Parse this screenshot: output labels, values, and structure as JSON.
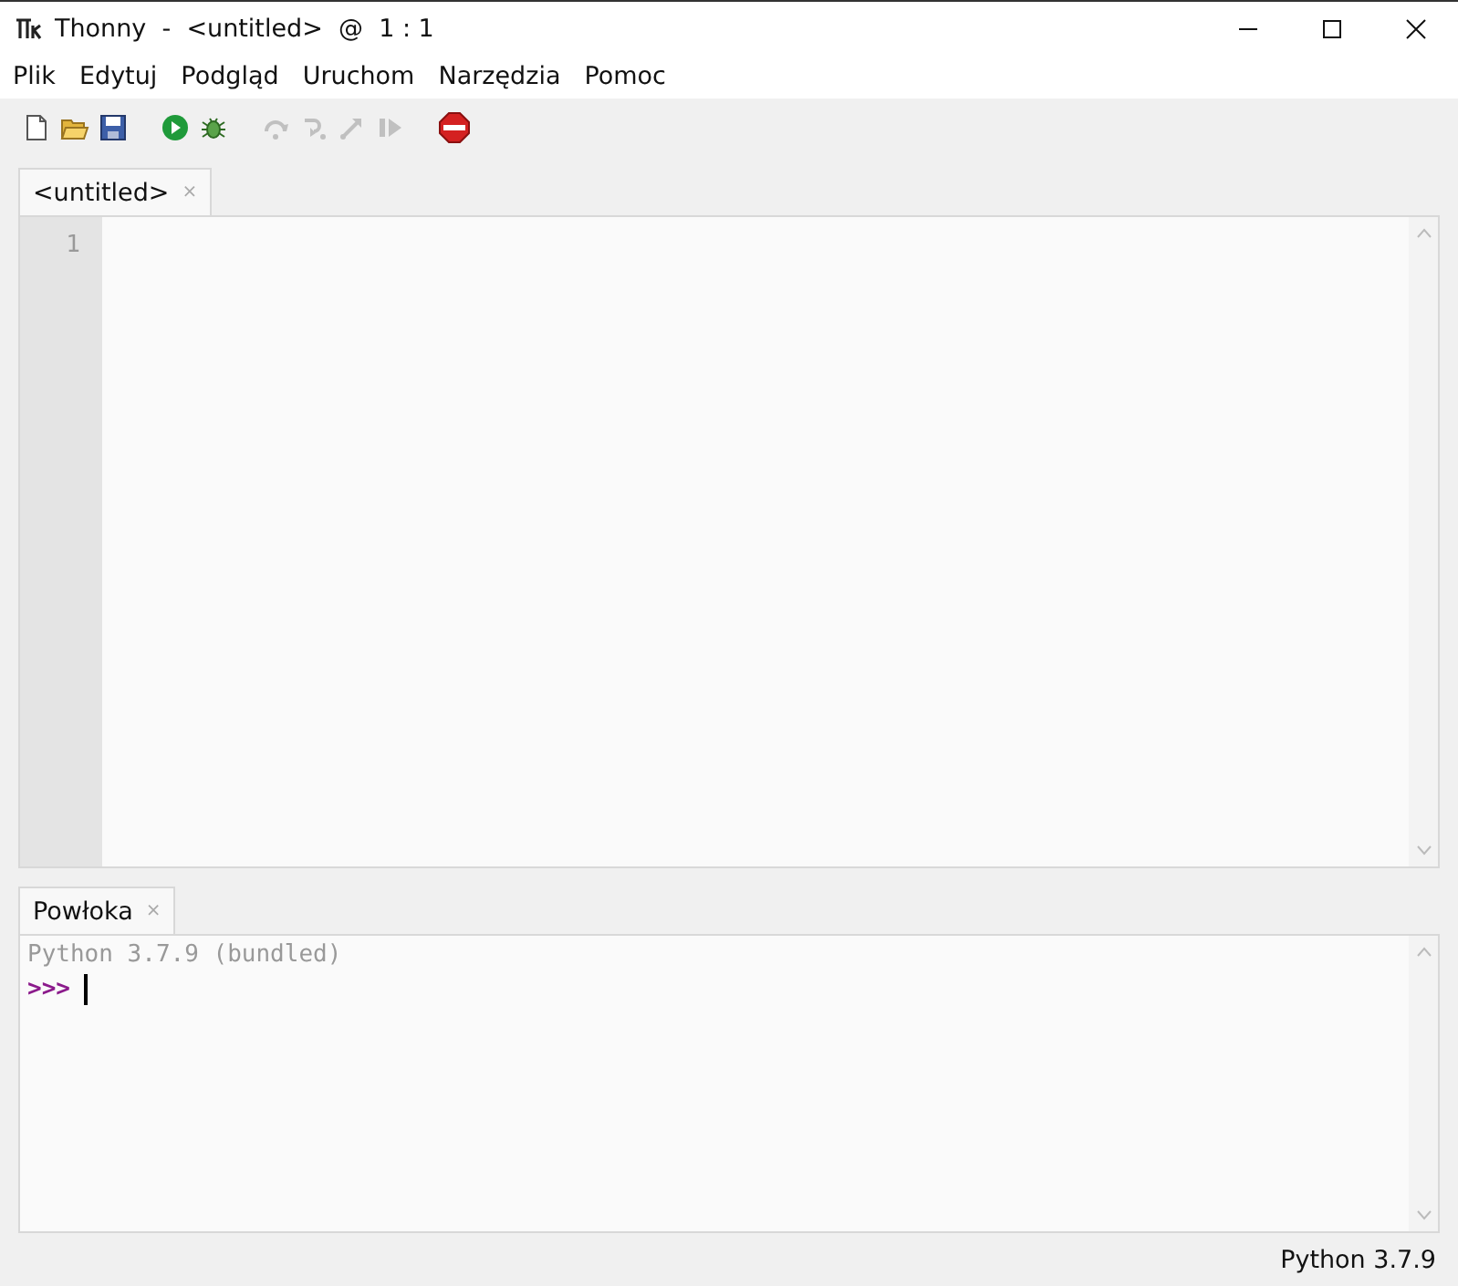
{
  "window": {
    "title": "Thonny  -  <untitled>  @  1 : 1"
  },
  "menu": [
    "Plik",
    "Edytuj",
    "Podgląd",
    "Uruchom",
    "Narzędzia",
    "Pomoc"
  ],
  "toolbar": [
    {
      "kind": "new",
      "disabled": false
    },
    {
      "kind": "open",
      "disabled": false
    },
    {
      "kind": "save",
      "disabled": false
    },
    {
      "kind": "run",
      "disabled": false
    },
    {
      "kind": "debug",
      "disabled": false
    },
    {
      "kind": "step_over",
      "disabled": true
    },
    {
      "kind": "step_into",
      "disabled": true
    },
    {
      "kind": "step_out",
      "disabled": true
    },
    {
      "kind": "resume",
      "disabled": true
    },
    {
      "kind": "stop",
      "disabled": false
    }
  ],
  "editor": {
    "tabs": [
      {
        "label": "<untitled>",
        "close": "×",
        "selected": true
      }
    ],
    "line_numbers": [
      "1"
    ]
  },
  "shell": {
    "tabs": [
      {
        "label": "Powłoka",
        "close": "×",
        "selected": true
      }
    ],
    "banner": "Python 3.7.9 (bundled)",
    "prompt": ">>>"
  },
  "status_bar": "Python 3.7.9"
}
